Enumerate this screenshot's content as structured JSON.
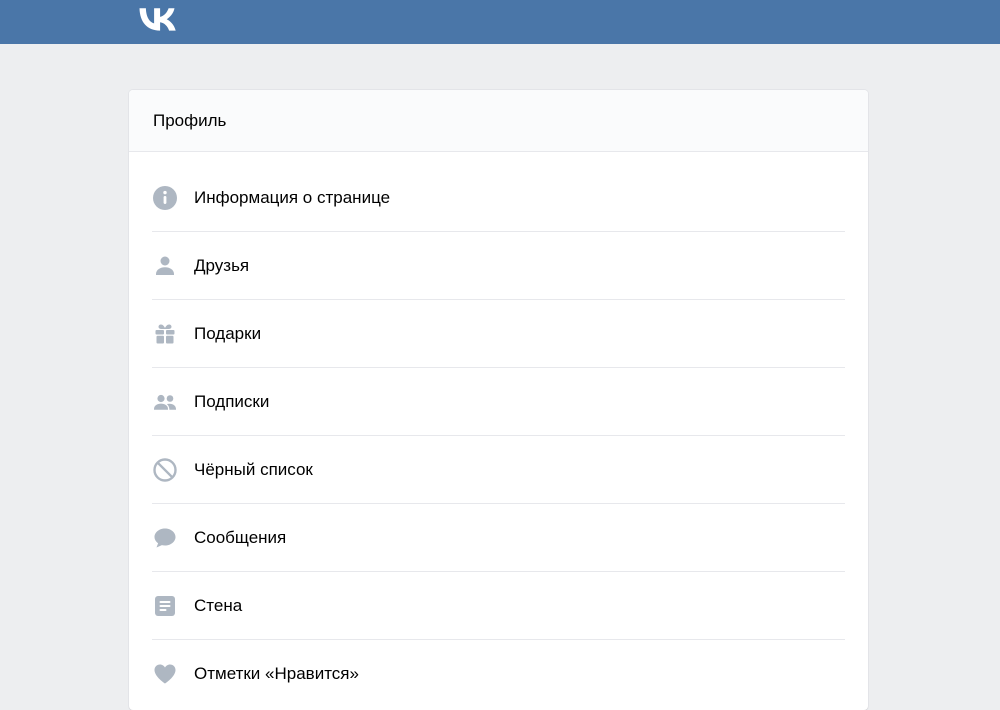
{
  "colors": {
    "header_bg": "#4a76a8",
    "page_bg": "#edeef0",
    "icon": "#aeb7c2",
    "divider": "#e7e8ec"
  },
  "header": {
    "logo": "vk-logo-icon"
  },
  "card": {
    "title": "Профиль",
    "items": [
      {
        "label": "Информация о странице",
        "icon": "info-icon"
      },
      {
        "label": "Друзья",
        "icon": "person-icon"
      },
      {
        "label": "Подарки",
        "icon": "gift-icon"
      },
      {
        "label": "Подписки",
        "icon": "people-icon"
      },
      {
        "label": "Чёрный список",
        "icon": "block-icon"
      },
      {
        "label": "Сообщения",
        "icon": "message-icon"
      },
      {
        "label": "Стена",
        "icon": "wall-icon"
      },
      {
        "label": "Отметки «Нравится»",
        "icon": "heart-icon"
      }
    ]
  }
}
